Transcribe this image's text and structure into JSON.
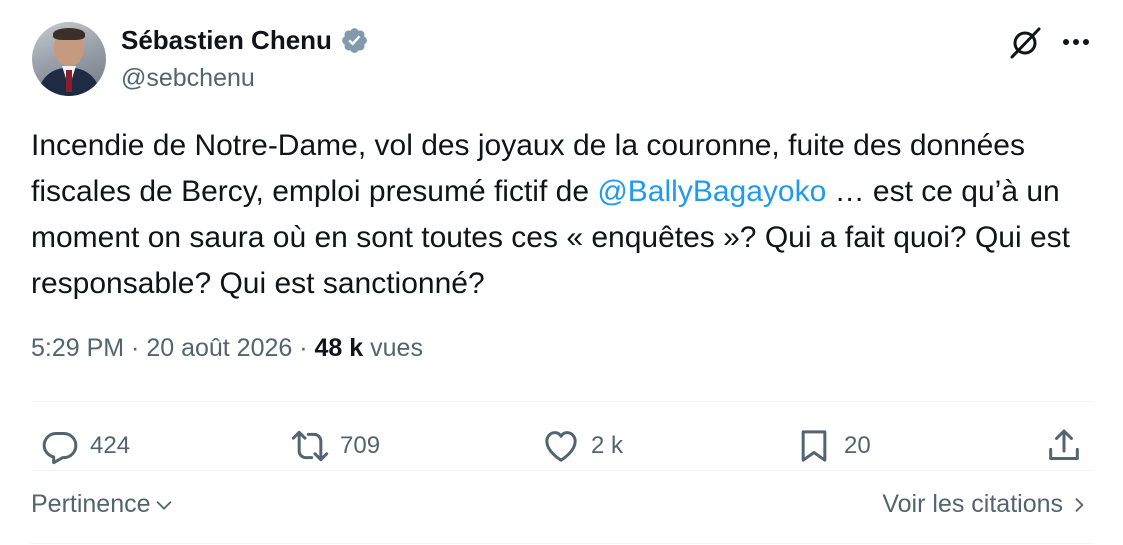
{
  "author": {
    "display_name": "Sébastien Chenu",
    "handle": "@sebchenu",
    "verified": true
  },
  "tweet": {
    "text_before_mention": "Incendie de Notre-Dame, vol des joyaux de la couronne, fuite des données fiscales de Bercy, emploi presumé fictif de ",
    "mention": "@BallyBagayoko",
    "text_after_mention": " … est ce qu’à un moment on saura où en sont toutes ces « enquêtes »? Qui a fait quoi? Qui est responsable? Qui est sanctionné?",
    "time": "5:29 PM",
    "date": "20 août 2026",
    "views_count": "48 k",
    "views_label": "vues"
  },
  "actions": {
    "replies": "424",
    "reposts": "709",
    "likes": "2 k",
    "bookmarks": "20"
  },
  "footer": {
    "sort_label": "Pertinence",
    "quotes_label": "Voir les citations"
  },
  "icons": [
    "grok-icon",
    "more-icon",
    "verified-badge-icon",
    "reply-icon",
    "repost-icon",
    "like-icon",
    "bookmark-icon",
    "share-icon",
    "chevron-down-icon",
    "chevron-right-icon"
  ],
  "colors": {
    "text": "#0f1419",
    "secondary": "#536471",
    "mention": "#1d9bf0",
    "verified_badge": "#829aab"
  }
}
